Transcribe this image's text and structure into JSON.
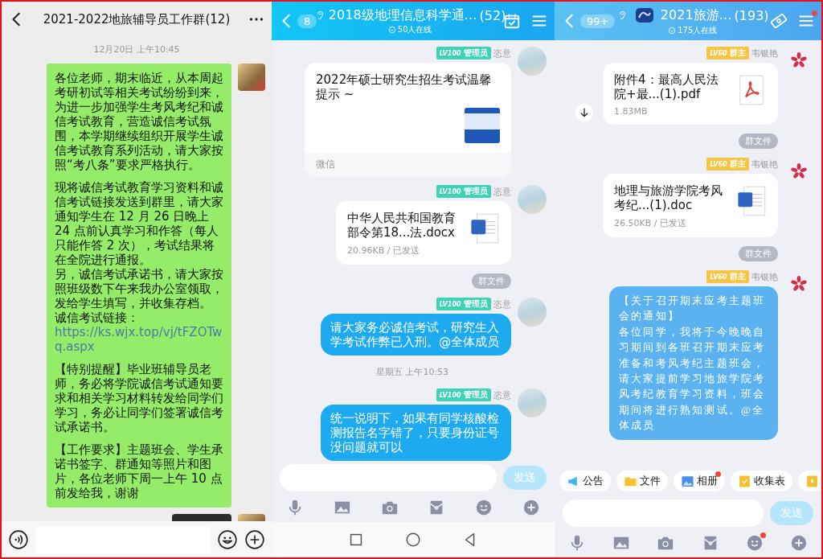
{
  "panels": [
    {
      "kind": "wechat",
      "header": {
        "title": "2021-2022地旅辅导员工作群(12)",
        "actions": [
          {
            "kind": "more",
            "dot": false
          }
        ]
      },
      "messages": [
        {
          "kind": "time",
          "text": "12月20日 上午10:45"
        },
        {
          "kind": "text",
          "avatar": {
            "kind": "photo"
          },
          "sections": [
            [
              {
                "text": "各位老师，期末临近，从本周起考研初试等相关考试纷纷到来，为进一步加强学生考风考纪和诚信考试教育，营造诚信考试氛围，本学期继续组织开展学生诚信考试教育系列活动，请大家按照“考八条”要求严格执行。"
              }
            ],
            [
              {
                "text": "现将诚信考试教育学习资料和诚信考试链接发送到群里，请大家通知学生在 12 月 26 日晚上 24 点前认真学习和作答（每人只能作答 2 次），考试结果将在全院进行通报。"
              },
              {
                "text": "另，诚信考试承诺书，请大家按照班级数下午来我办公室领取，发给学生填写，并收集存档。"
              },
              {
                "text": "诚信考试链接：",
                "link": "https://ks.wjx.top/vj/tFZOTwq.aspx"
              }
            ],
            [
              {
                "text": "【特别提醒】毕业班辅导员老师，务必将学院诚信考试通知要求和相关学习材料转发给同学们学习，务必让同学们签署诚信考试承诺书。"
              }
            ],
            [
              {
                "text": "【工作要求】主题班会、学生承诺书签字、群通知等照片和图片，各位老师下周一上午 10 点前发给我，谢谢"
              }
            ]
          ]
        },
        {
          "kind": "dark",
          "avatar": {
            "kind": "photo"
          }
        }
      ],
      "composer": [
        {
          "kind": "voice"
        },
        {
          "kind": "field"
        },
        {
          "kind": "emoji"
        },
        {
          "kind": "plus"
        }
      ]
    },
    {
      "kind": "qq",
      "header": {
        "back_count": "8",
        "title": "2018级地理信息科学通…",
        "count": "(52)",
        "online": "50人在线",
        "logo": false,
        "actions": [
          {
            "kind": "calendar",
            "dot": false
          },
          {
            "kind": "menu",
            "dot": false
          }
        ]
      },
      "messages": [
        {
          "kind": "link",
          "avatar": {
            "kind": "photo"
          },
          "sender": {
            "level": "LV100",
            "role": "管理员",
            "name": "恣意",
            "color": "#3ed3b4"
          },
          "title": "2022年硕士研究生招生考试温馨提示 ~",
          "source": "微信"
        },
        {
          "kind": "file",
          "avatar": {
            "kind": "photo"
          },
          "sender": {
            "level": "LV100",
            "role": "管理员",
            "name": "恣意",
            "color": "#3ed3b4"
          },
          "file_icon": {
            "kind": "word"
          },
          "name": "中华人民共和国教育部令第18...法.docx",
          "meta": "20.96KB / 已发送",
          "download": false
        },
        {
          "kind": "pill",
          "text": "群文件"
        },
        {
          "kind": "text",
          "avatar": {
            "kind": "photo"
          },
          "sender": {
            "level": "LV100",
            "role": "管理员",
            "name": "恣意",
            "color": "#3ed3b4"
          },
          "sections": [
            [
              {
                "text": "请大家务必诚信考试，研究生入学考试作弊已入刑。@全体成员"
              }
            ]
          ]
        },
        {
          "kind": "time",
          "text": "星期五 上午10:53"
        },
        {
          "kind": "text",
          "avatar": {
            "kind": "photo"
          },
          "sender": {
            "level": "LV100",
            "role": "管理员",
            "name": "恣意",
            "color": "#3ed3b4"
          },
          "sections": [
            [
              {
                "text": "统一说明下，如果有同学核酸检测报告名字错了，只要身份证号没问题就可以"
              }
            ]
          ]
        }
      ],
      "composer": [
        {
          "kind": "field"
        },
        {
          "kind": "send",
          "label": "发送",
          "disabled": true
        }
      ],
      "toolbar": [
        {
          "kind": "mic",
          "dot": false
        },
        {
          "kind": "image",
          "dot": false
        },
        {
          "kind": "camera",
          "dot": false
        },
        {
          "kind": "redpacket",
          "dot": false
        },
        {
          "kind": "emoji",
          "dot": false
        },
        {
          "kind": "plus",
          "dot": false
        }
      ],
      "nav": [
        {
          "kind": "square"
        },
        {
          "kind": "circle"
        },
        {
          "kind": "back"
        }
      ]
    },
    {
      "kind": "qq",
      "header": {
        "back_count": "99+",
        "title": "2021旅游…",
        "count": "(193)",
        "online": "175人在线",
        "logo": true,
        "actions": [
          {
            "kind": "ticket",
            "dot": false
          },
          {
            "kind": "menu",
            "dot": true
          }
        ]
      },
      "messages": [
        {
          "kind": "file",
          "avatar": {
            "kind": "flower"
          },
          "sender": {
            "level": "LV60",
            "role": "群主",
            "name": "韦银艳",
            "color": "#f5c645"
          },
          "file_icon": {
            "kind": "pdf"
          },
          "name": "附件4：最高人民法院+最...(1).pdf",
          "meta": "1.83MB",
          "download": true
        },
        {
          "kind": "pill",
          "text": "群文件"
        },
        {
          "kind": "file",
          "avatar": {
            "kind": "flower"
          },
          "sender": {
            "level": "LV60",
            "role": "群主",
            "name": "韦银艳",
            "color": "#f5c645"
          },
          "file_icon": {
            "kind": "word"
          },
          "name": "地理与旅游学院考风考纪...(1).doc",
          "meta": "26.50KB / 已发送",
          "download": false
        },
        {
          "kind": "pill",
          "text": "群文件"
        },
        {
          "kind": "styled_text",
          "avatar": {
            "kind": "flower"
          },
          "sender": {
            "level": "LV60",
            "role": "群主",
            "name": "韦银艳",
            "color": "#f5c645"
          },
          "sections": [
            [
              {
                "text": "【关于召开期末应考主题班会的通知】"
              },
              {
                "text": "各位同学，我将于今晚晚自习期间到各班召开期末应考准备和考风考纪主题班会，请大家提前学习地旅学院考风考纪教育学习资料，班会期间将进行熟知测试。@全体成员"
              }
            ]
          ]
        }
      ],
      "quick_bar": [
        {
          "kind": "notice",
          "label": "公告",
          "dot": false
        },
        {
          "kind": "folder",
          "label": "文件",
          "dot": false
        },
        {
          "kind": "album",
          "label": "相册",
          "dot": true
        },
        {
          "kind": "form",
          "label": "收集表",
          "dot": false
        },
        {
          "kind": "app",
          "dot": false
        }
      ],
      "composer": [
        {
          "kind": "field"
        },
        {
          "kind": "send",
          "label": "发送",
          "disabled": true
        }
      ],
      "toolbar": [
        {
          "kind": "mic",
          "dot": false
        },
        {
          "kind": "image",
          "dot": false
        },
        {
          "kind": "camera",
          "dot": false
        },
        {
          "kind": "redpacket",
          "dot": false
        },
        {
          "kind": "emoji",
          "dot": true
        },
        {
          "kind": "plus",
          "dot": false
        }
      ]
    }
  ]
}
